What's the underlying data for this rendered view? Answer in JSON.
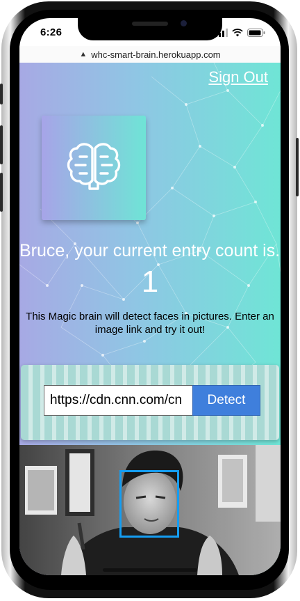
{
  "status_bar": {
    "time": "6:26",
    "icons": [
      "signal-bars-icon",
      "wifi-icon",
      "battery-icon"
    ]
  },
  "browser": {
    "url": "whc-smart-brain.herokuapp.com",
    "url_icon": "warning-triangle-icon"
  },
  "nav": {
    "sign_out": "Sign Out"
  },
  "logo": {
    "icon": "brain-icon"
  },
  "rank": {
    "headline": "Bruce, your current entry count is..",
    "count": "1"
  },
  "instructions": "This Magic brain will detect faces in pictures. Enter an image link and try it out!",
  "form": {
    "image_url_value": "https://cdn.cnn.com/cn",
    "detect_label": "Detect"
  },
  "colors": {
    "gradient_left": "#a7a9e4",
    "gradient_right": "#6fe5d6",
    "detect_button": "#3f7fdc",
    "face_box": "#149df2"
  }
}
